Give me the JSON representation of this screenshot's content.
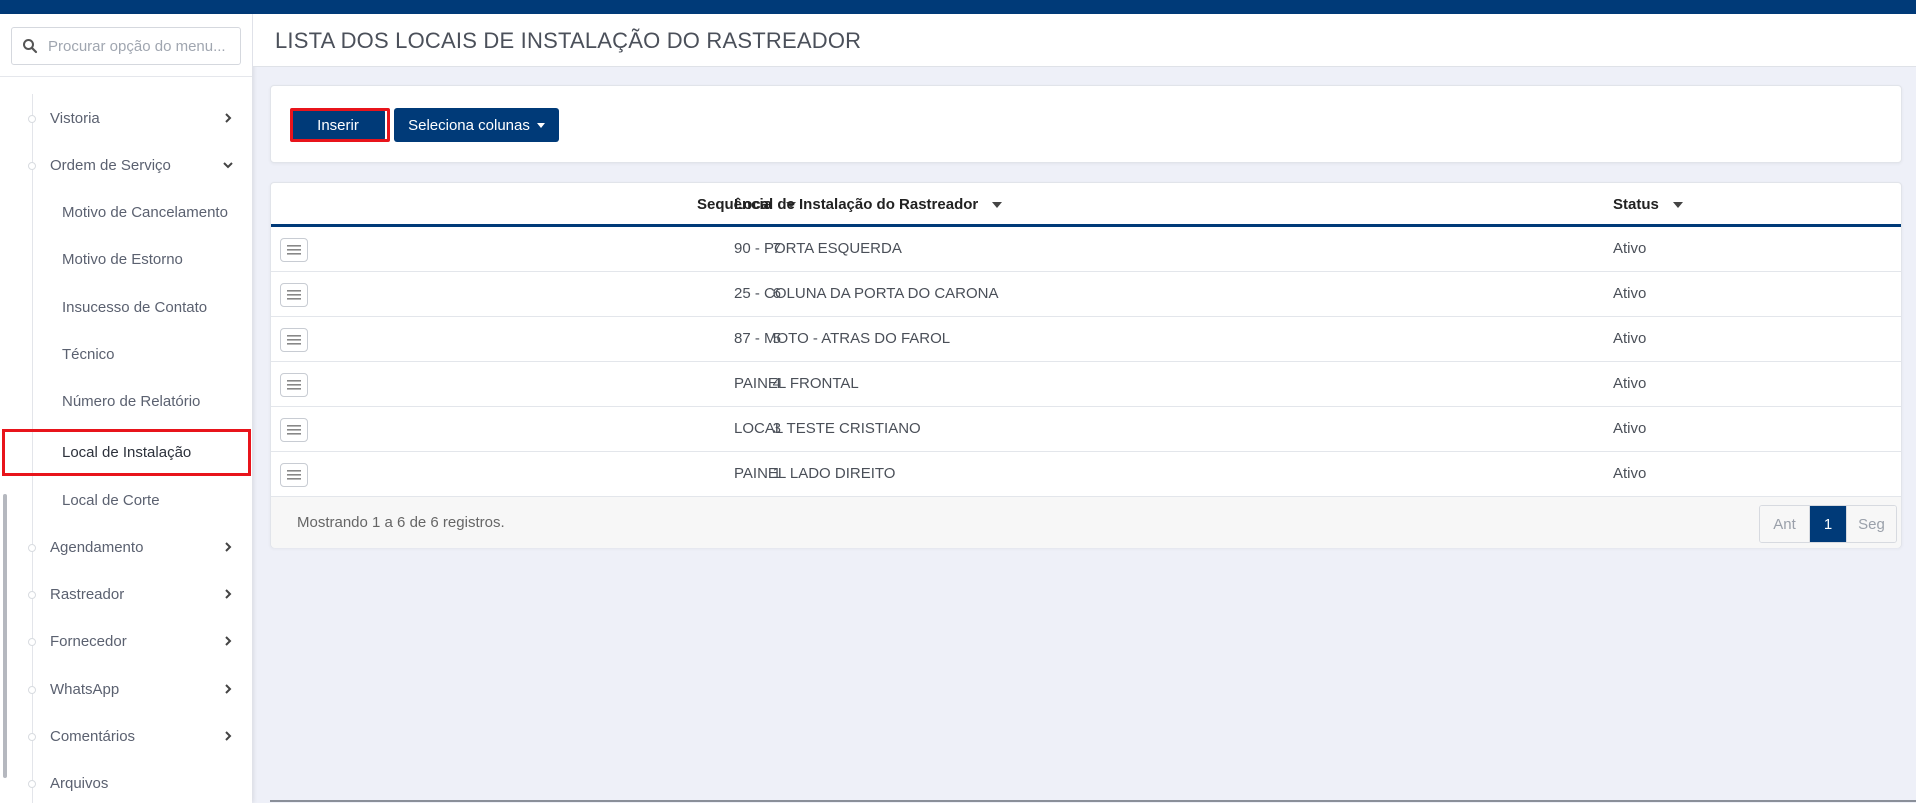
{
  "sidebar": {
    "search_placeholder": "Procurar opção do menu...",
    "items": [
      {
        "label": "Vistoria"
      },
      {
        "label": "Ordem de Serviço"
      },
      {
        "label": "Motivo de Cancelamento"
      },
      {
        "label": "Motivo de Estorno"
      },
      {
        "label": "Insucesso de Contato"
      },
      {
        "label": "Técnico"
      },
      {
        "label": "Número de Relatório"
      },
      {
        "label": "Local de Instalação"
      },
      {
        "label": "Local de Corte"
      },
      {
        "label": "Agendamento"
      },
      {
        "label": "Rastreador"
      },
      {
        "label": "Fornecedor"
      },
      {
        "label": "WhatsApp"
      },
      {
        "label": "Comentários"
      },
      {
        "label": "Arquivos"
      }
    ]
  },
  "header": {
    "title": "LISTA DOS LOCAIS DE INSTALAÇÃO DO RASTREADOR"
  },
  "toolbar": {
    "insert_label": "Inserir",
    "columns_label": "Seleciona colunas"
  },
  "table": {
    "columns": [
      "Sequência",
      "Local de Instalação do Rastreador",
      "Status"
    ],
    "rows": [
      {
        "seq": "7",
        "local": "90 - PORTA ESQUERDA",
        "status": "Ativo"
      },
      {
        "seq": "6",
        "local": "25 - COLUNA DA PORTA DO CARONA",
        "status": "Ativo"
      },
      {
        "seq": "5",
        "local": "87 - MOTO - ATRAS DO FAROL",
        "status": "Ativo"
      },
      {
        "seq": "4",
        "local": "PAINEL FRONTAL",
        "status": "Ativo"
      },
      {
        "seq": "3",
        "local": "LOCAL TESTE CRISTIANO",
        "status": "Ativo"
      },
      {
        "seq": "1",
        "local": "PAINEL LADO DIREITO",
        "status": "Ativo"
      }
    ],
    "footer_info": "Mostrando 1 a 6 de 6 registros.",
    "pagination": {
      "prev": "Ant",
      "current": "1",
      "next": "Seg"
    }
  },
  "colors": {
    "brand": "#003a78",
    "highlight": "#e8141b"
  }
}
